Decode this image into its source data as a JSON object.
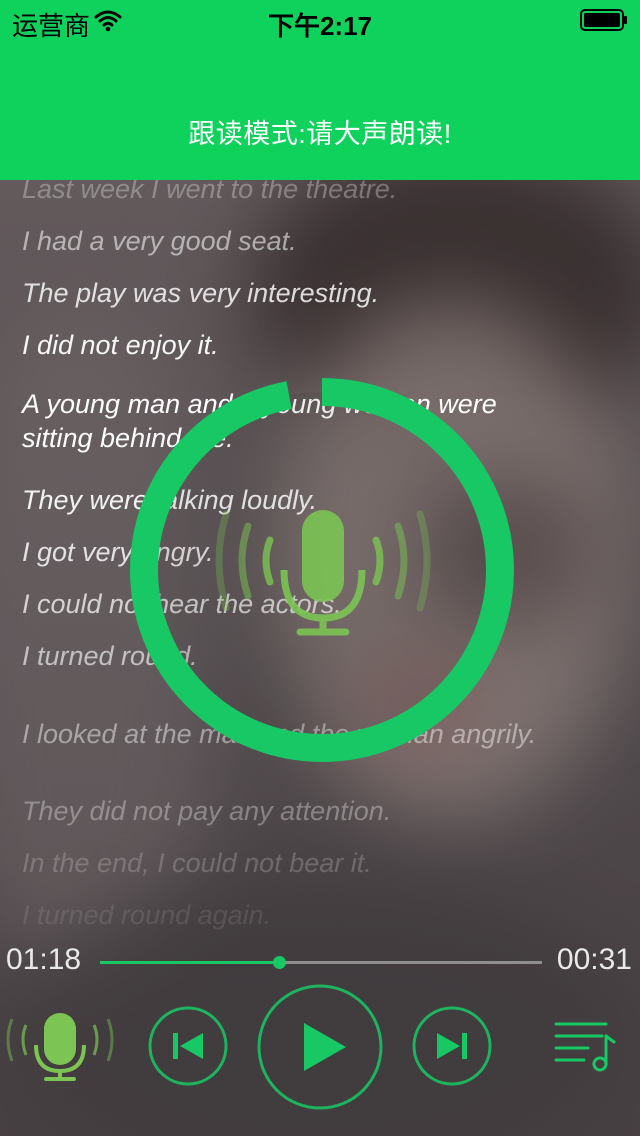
{
  "status_bar": {
    "carrier": "运营商",
    "time": "下午2:17"
  },
  "header": {
    "title": "跟读模式:请大声朗读!"
  },
  "transcript": {
    "lines": [
      "Last week I went to the theatre.",
      "I had a very good seat.",
      "The play was very interesting.",
      "I did not enjoy it.",
      "A young man and a young woman were",
      "sitting behind me.",
      "They were talking loudly.",
      "I got very angry.",
      "I could not hear the actors.",
      "I turned round.",
      "I looked at the man and the woman angrily.",
      "They did not pay any attention.",
      "In the end, I could not bear it.",
      "I turned round again."
    ]
  },
  "player": {
    "elapsed": "01:18",
    "total": "00:31",
    "progress": 0.405
  },
  "recording": {
    "progress": 0.97
  },
  "icons": {
    "status": [
      "wifi-icon",
      "battery-icon"
    ],
    "recording": "microphone-icon",
    "controls": [
      "microphone-icon",
      "skip-previous-icon",
      "play-icon",
      "skip-next-icon",
      "playlist-music-icon"
    ]
  },
  "colors": {
    "header": "#0fd25c",
    "accent": "#18c865",
    "mic": "#7cc454"
  }
}
